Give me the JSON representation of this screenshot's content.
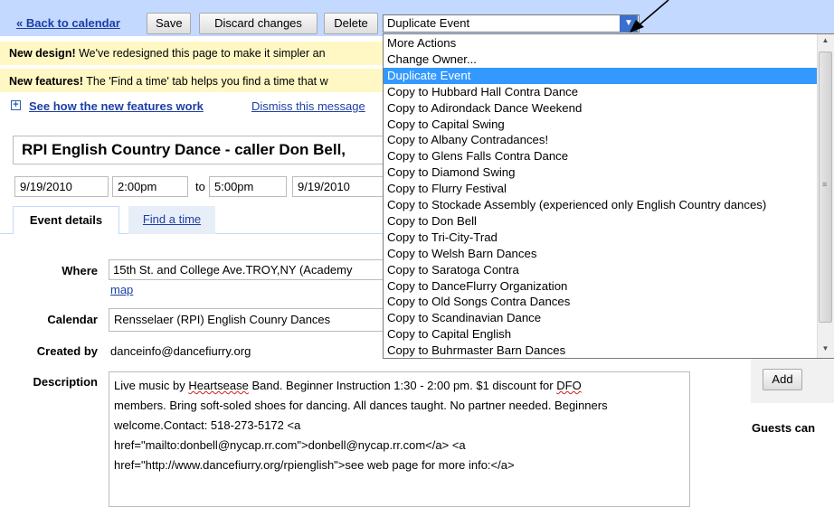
{
  "toolbar": {
    "back_link": "« Back to calendar",
    "save": "Save",
    "discard": "Discard changes",
    "delete": "Delete",
    "actions_selected": "Duplicate Event",
    "arrow_glyph": "▼"
  },
  "messages": {
    "design_bold": "New design!",
    "design_text": " We've redesigned this page to make it simpler an",
    "features_bold": "New features!",
    "features_text": " The 'Find a time' tab helps you find a time that w",
    "see_how": "See how the new features work",
    "dismiss": "Dismiss this message",
    "plus_glyph": "+"
  },
  "event": {
    "title": "RPI English Country Dance - caller Don Bell,",
    "start_date": "9/19/2010",
    "start_time": "2:00pm",
    "to_label": "to",
    "end_time": "5:00pm",
    "end_date": "9/19/2010"
  },
  "tabs": {
    "details": "Event details",
    "find_time": "Find a time"
  },
  "details": {
    "where_label": "Where",
    "where_value": "15th St. and College Ave.TROY,NY (Academy",
    "map_link": "map",
    "calendar_label": "Calendar",
    "calendar_value": "Rensselaer (RPI) English Counry Dances",
    "created_label": "Created by",
    "created_value": "danceinfo@dancefiurry.org",
    "description_label": "Description",
    "desc_line1_a": "Live music by ",
    "desc_line1_b": "Heartsease",
    "desc_line1_c": " Band. Beginner Instruction 1:30 - 2:00 pm. $1 discount for ",
    "desc_line1_d": "DFO",
    "desc_line2": "members. Bring soft-soled shoes for dancing. All dances taught. No partner needed. Beginners",
    "desc_line3": "welcome.Contact: 518-273-5172 <a",
    "desc_line4": "href=\"mailto:donbell@nycap.rr.com\">donbell@nycap.rr.com</a> <a",
    "desc_line5": "href=\"http://www.dancefiurry.org/rpienglish\">see web page for more info:</a>"
  },
  "dropdown": {
    "items": [
      "More Actions",
      "Change Owner...",
      "Duplicate Event",
      "Copy to Hubbard Hall Contra Dance",
      "Copy to Adirondack Dance Weekend",
      "Copy to Capital Swing",
      "Copy to Albany Contradances!",
      "Copy to Glens Falls Contra Dance",
      "Copy to Diamond Swing",
      "Copy to Flurry Festival",
      "Copy to Stockade Assembly (experienced only English Country dances)",
      "Copy to Don Bell",
      "Copy to Tri-City-Trad",
      "Copy to Welsh Barn Dances",
      "Copy to Saratoga Contra",
      "Copy to DanceFlurry Organization",
      "Copy to Old Songs Contra Dances",
      "Copy to Scandinavian Dance",
      "Copy to Capital English",
      "Copy to Buhrmaster Barn Dances"
    ],
    "selected_index": 2,
    "scroll_up": "▲",
    "scroll_down": "▼"
  },
  "right": {
    "add": "Add",
    "guests_can": "Guests can"
  },
  "colors": {
    "toolbar_bg": "#c3d9ff",
    "message_bg": "#fff8c4",
    "link": "#1c3ea6",
    "selected": "#3399ff"
  }
}
